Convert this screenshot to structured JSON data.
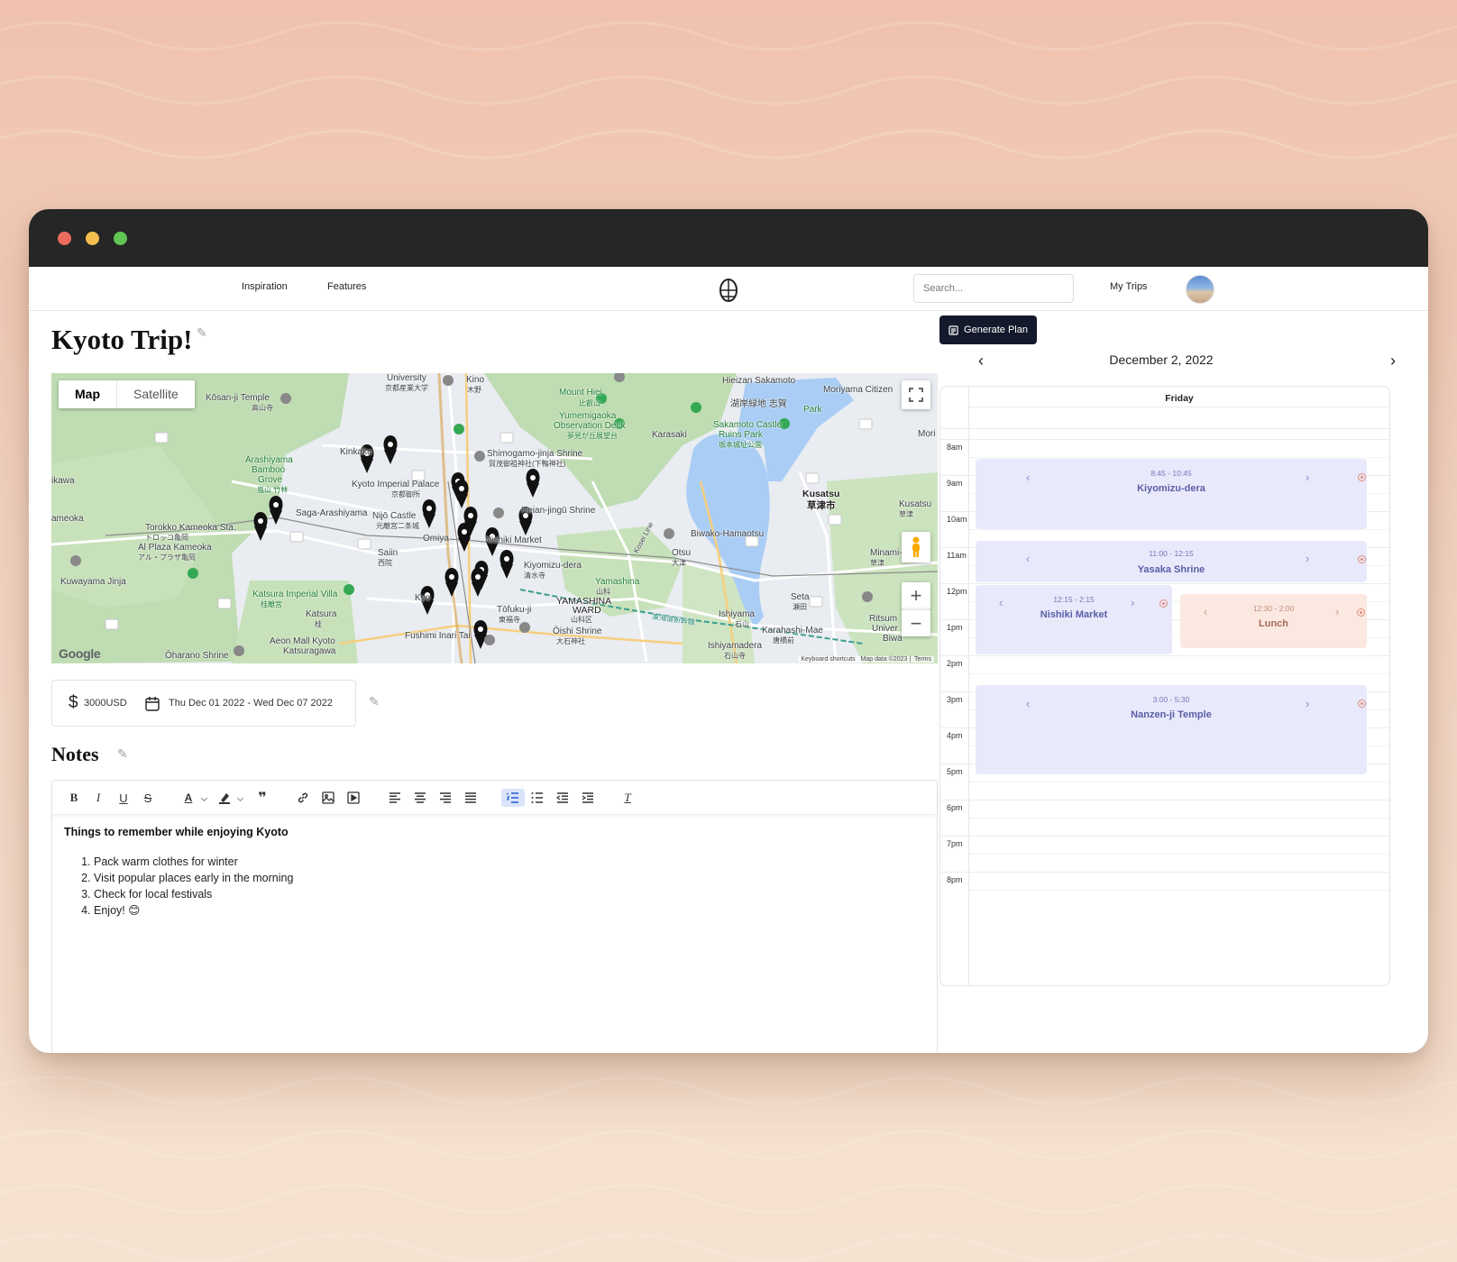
{
  "nav": {
    "links": [
      "Inspiration",
      "Features"
    ],
    "search_placeholder": "Search...",
    "my_trips": "My Trips"
  },
  "trip": {
    "title": "Kyoto Trip!",
    "budget_amount": "3000USD",
    "dates": "Thu Dec 01 2022 - Wed Dec 07 2022"
  },
  "map": {
    "tabs": [
      "Map",
      "Satellite"
    ],
    "active_tab": "Map",
    "attribution": [
      "Keyboard shortcuts",
      "Map data ©2023",
      "Terms"
    ],
    "provider": "Google",
    "labels": {
      "kosanji": "Kōsan-ji Temple",
      "kosanji_jp": "高山寺",
      "university": "University",
      "kyoto_u": "京都産業大学",
      "kino": "Kino",
      "kino_jp": "木野",
      "mount_hiei": "Mount Hiei",
      "mount_hiei_jp": "比叡山",
      "hieizan": "Hieizan Sakamoto",
      "hieizan_jp": "湖岸緑地 志賀",
      "park": "Park",
      "moriyama": "Moriyama Citizen",
      "yumemigaoka": "Yumemigaoka",
      "observation": "Observation Deck",
      "observation_jp": "夢見が丘展望台",
      "karasaki": "Karasaki",
      "sakamoto": "Sakamoto Castle",
      "ruins": "Ruins Park",
      "ruins_jp": "坂本城址公園",
      "kinkaku": "Kinkaku",
      "arashiyama": "Arashiyama",
      "bamboo": "Bamboo",
      "grove": "Grove",
      "grove_jp": "嵐山 竹林",
      "shimogamo": "Shimogamo-jinja Shrine",
      "shimogamo_jp": "賀茂御祖神社(下鴨神社)",
      "imperial": "Kyoto Imperial Palace",
      "imperial_jp": "京都御所",
      "kusatsu": "Kusatsu",
      "kusatsu_jp": "草津市",
      "kameoka": "ameoka",
      "kawa": "ikawa",
      "saga": "Saga-Arashiyama",
      "nijo": "Nijō Castle",
      "nijo_jp": "元離宮二条城",
      "heian": "Heian-jingū Shrine",
      "torokko": "Torokko Kameoka Sta.",
      "torokko_jp": "トロッコ亀岡",
      "omiya": "Omiya",
      "nishiki": "Nishiki Market",
      "biwako": "Biwako-Hamaotsu",
      "kusatsu_east": "Kusatsu",
      "kusatsu_east_jp": "草津",
      "plaza": "Al Plaza Kameoka",
      "plaza_jp": "アル・プラザ亀岡",
      "saiin": "Saiin",
      "saiin_jp": "西院",
      "kiyomizu": "Kiyomizu-dera",
      "kiyomizu_jp": "清水寺",
      "otsu": "Otsu",
      "otsu_jp": "大津",
      "minami": "Minami-",
      "minami_jp": "草津",
      "kuwayama": "Kuwayama Jinja",
      "yamashina": "Yamashina",
      "yamashina_jp": "山科",
      "katsura_villa": "Katsura Imperial Villa",
      "katsura_villa_jp": "桂離宮",
      "yamashina_ward": "YAMASHINA",
      "yamashina_ward2": "WARD",
      "yamashina_ward_jp": "山科区",
      "seta": "Seta",
      "seta_jp": "瀬田",
      "katsura": "Katsura",
      "katsura_jp": "桂",
      "kyo": "Kyo",
      "tofukuji": "Tōfuku-ji",
      "tofukuji_jp": "東福寺",
      "ishiyama": "Ishiyama",
      "ishiyama_jp": "石山",
      "karahashi": "Karahashi-Mae",
      "karahashi_jp": "唐橋前",
      "ritsum": "Ritsum",
      "univer": "Univer",
      "biwa": "Biwa",
      "aeon": "Aeon Mall Kyoto",
      "aeon2": "Katsuragawa",
      "fushimi": "Fushimi Inari Tai",
      "oishi": "Ōishi Shrine",
      "oishi_jp": "大石神社",
      "oharano": "Ōharano Shrine",
      "ishiyamadera": "Ishiyamadera",
      "ishiyamadera_jp": "石山寺",
      "mori": "Mori",
      "kosei": "Kosei Line",
      "shinkansen": "東海道新幹線"
    }
  },
  "notes": {
    "title": "Notes",
    "heading": "Things to remember while enjoying Kyoto",
    "items": [
      "Pack warm clothes for winter",
      "Visit popular places early in the morning",
      "Check for local festivals",
      "Enjoy! 😊"
    ]
  },
  "calendar": {
    "generate_label": "Generate Plan",
    "month_label": "December 2, 2022",
    "day_label": "Friday",
    "hours": [
      "8am",
      "9am",
      "10am",
      "11am",
      "12pm",
      "1pm",
      "2pm",
      "3pm",
      "4pm",
      "5pm",
      "6pm",
      "7pm",
      "8pm"
    ],
    "events": [
      {
        "time": "8:45 - 10:45",
        "name": "Kiyomizu-dera"
      },
      {
        "time": "11:00 - 12:15",
        "name": "Yasaka Shrine"
      },
      {
        "time": "12:15 - 2:15",
        "name": "Nishiki Market"
      },
      {
        "time": "12:30 - 2:00",
        "name": "Lunch"
      },
      {
        "time": "3:00 - 5:30",
        "name": "Nanzen-ji Temple"
      }
    ]
  },
  "colors": {
    "accent_dark": "#141a2b",
    "event_bg": "#e9e9fc",
    "lunch_bg": "#fbe8e1",
    "active_tool": "#2158d6"
  }
}
